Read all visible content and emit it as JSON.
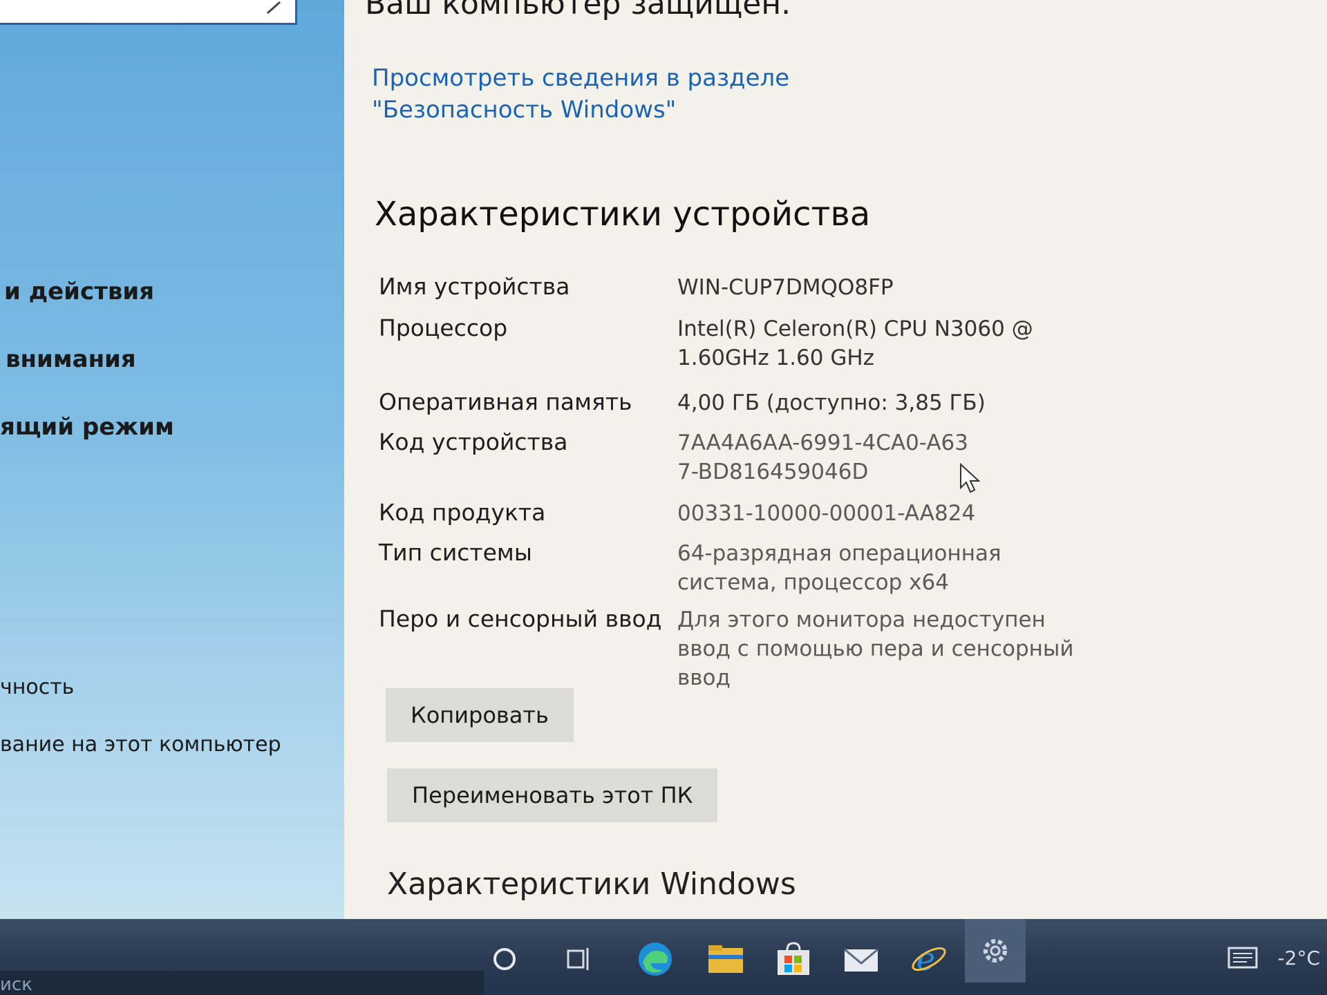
{
  "sidebar": {
    "items": [
      {
        "label": "и действия"
      },
      {
        "label": "внимания"
      },
      {
        "label": "ящий режим"
      },
      {
        "label": "чность"
      },
      {
        "label": "вание на этот компьютер"
      }
    ],
    "bottom_label": "иск"
  },
  "main": {
    "status_title": "Ваш компьютер защищен.",
    "security_link": "Просмотреть сведения в разделе \"Безопасность Windows\"",
    "device_specs_title": "Характеристики устройства",
    "specs": [
      {
        "label": "Имя устройства",
        "value": "WIN-CUP7DMQO8FP"
      },
      {
        "label": "Процессор",
        "value": "Intel(R) Celeron(R) CPU  N3060  @ 1.60GHz 1.60 GHz"
      },
      {
        "label": "Оперативная память",
        "value": "4,00 ГБ (доступно: 3,85 ГБ)"
      },
      {
        "label": "Код устройства",
        "value": "7AA4A6AA-6991-4CA0-A637-BD816459046D"
      },
      {
        "label": "Код продукта",
        "value": "00331-10000-00001-AA824"
      },
      {
        "label": "Тип системы",
        "value": "64-разрядная операционная система, процессор x64"
      },
      {
        "label": "Перо и сенсорный ввод",
        "value": "Для этого монитора недоступен ввод с помощью пера и сенсорный ввод"
      }
    ],
    "copy_button": "Копировать",
    "rename_button": "Переименовать этот ПК",
    "windows_specs_title": "Характеристики Windows"
  },
  "taskbar": {
    "icons": [
      "cortana-circle-icon",
      "task-view-icon",
      "edge-icon",
      "file-explorer-icon",
      "store-icon",
      "mail-icon",
      "internet-explorer-icon",
      "settings-gear-icon"
    ],
    "temperature": "-2°C"
  },
  "colors": {
    "link": "#1a63b5",
    "sidebar": "#7fbde4",
    "main_bg": "#f2f1ea",
    "taskbar": "#2a3b52"
  }
}
